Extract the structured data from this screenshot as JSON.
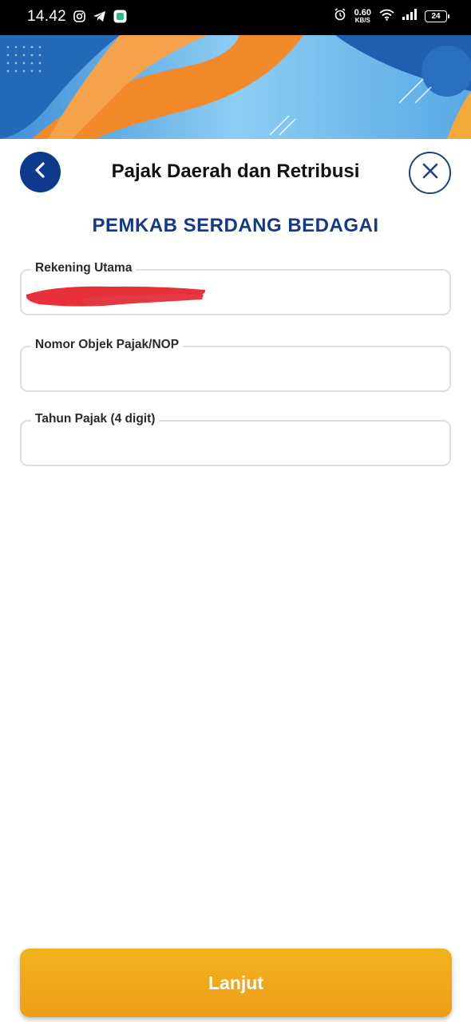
{
  "status_bar": {
    "time": "14.42",
    "net_speed_value": "0.60",
    "net_speed_unit": "KB/S",
    "battery": "24",
    "left_icons": [
      "instagram-icon",
      "telegram-icon",
      "app-notification-icon"
    ],
    "right_icons": [
      "alarm-icon",
      "wifi-icon",
      "signal-icon",
      "battery-icon"
    ]
  },
  "header": {
    "title": "Pajak Daerah dan Retribusi",
    "subtitle": "PEMKAB SERDANG BEDAGAI",
    "back_icon": "chevron-left-icon",
    "close_icon": "close-icon"
  },
  "form": {
    "fields": [
      {
        "label": "Rekening Utama",
        "value": "",
        "redacted": true
      },
      {
        "label": "Nomor Objek Pajak/NOP",
        "value": ""
      },
      {
        "label": "Tahun Pajak (4 digit)",
        "value": ""
      }
    ]
  },
  "footer": {
    "submit_label": "Lanjut"
  },
  "colors": {
    "primary_navy": "#0d3a8c",
    "subtitle_blue": "#14388a",
    "button_orange": "#f0a51c",
    "field_border": "#dedede",
    "banner_orange": "#f2892a",
    "banner_blue": "#6ab7ee",
    "redaction_red": "#e8303a"
  }
}
